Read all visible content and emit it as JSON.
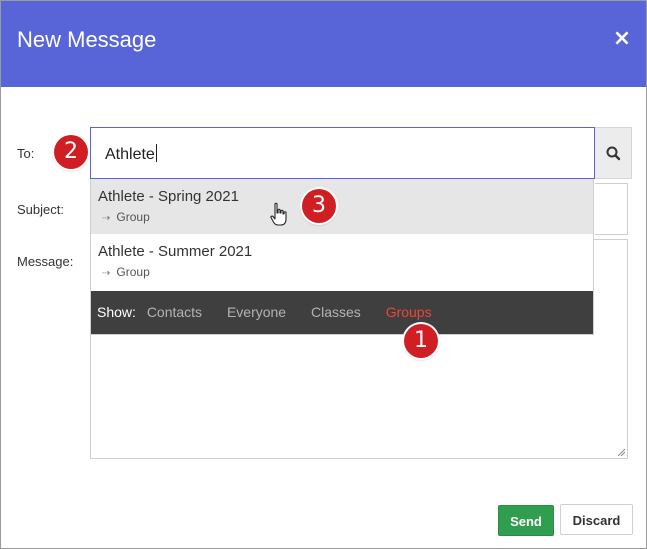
{
  "dialog": {
    "title": "New Message",
    "close_glyph": "×"
  },
  "form": {
    "to_label": "To:",
    "to_value": "Athlete",
    "subject_label": "Subject:",
    "message_label": "Message:"
  },
  "suggestions": [
    {
      "title": "Athlete - Spring 2021",
      "type": "Group"
    },
    {
      "title": "Athlete - Summer 2021",
      "type": "Group"
    }
  ],
  "show_bar": {
    "label": "Show:",
    "filters": [
      "Contacts",
      "Everyone",
      "Classes",
      "Groups"
    ],
    "active": "Groups"
  },
  "badges": [
    "1",
    "2",
    "3"
  ],
  "buttons": {
    "send": "Send",
    "discard": "Discard"
  },
  "colors": {
    "header": "#5865d9",
    "send": "#2f9e4f",
    "active_filter": "#e8463c",
    "badge": "#cf1f25"
  },
  "icons": {
    "search": "magnifier-icon",
    "close": "close-icon",
    "cursor": "hand-pointer-icon"
  }
}
